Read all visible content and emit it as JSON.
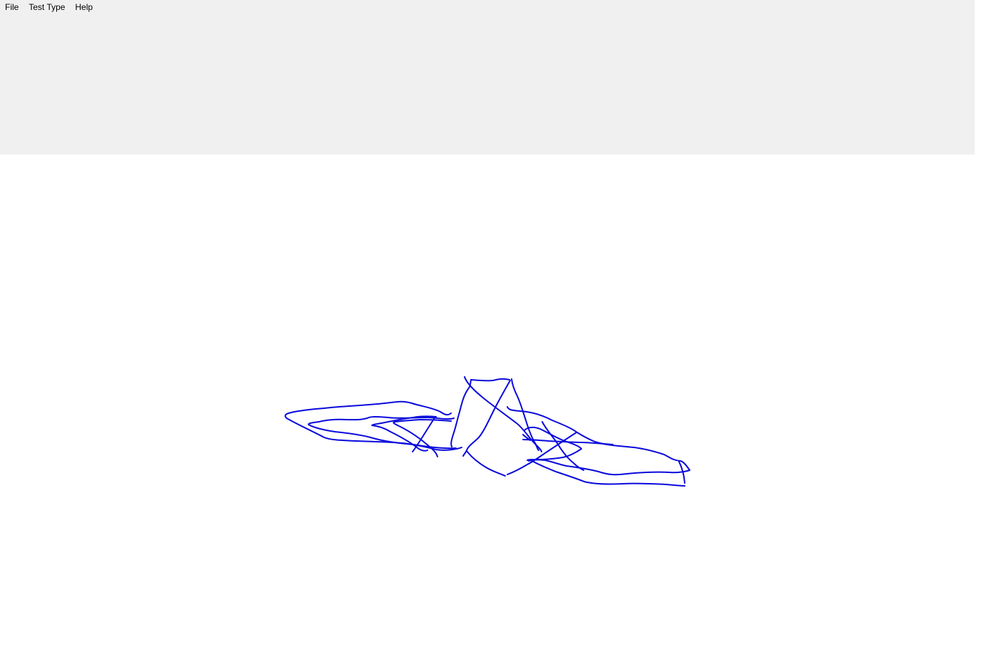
{
  "menu": {
    "items": [
      {
        "label": "File"
      },
      {
        "label": "Test Type"
      },
      {
        "label": "Help"
      }
    ]
  },
  "canvas": {
    "stroke_color": "#0a0adc"
  }
}
